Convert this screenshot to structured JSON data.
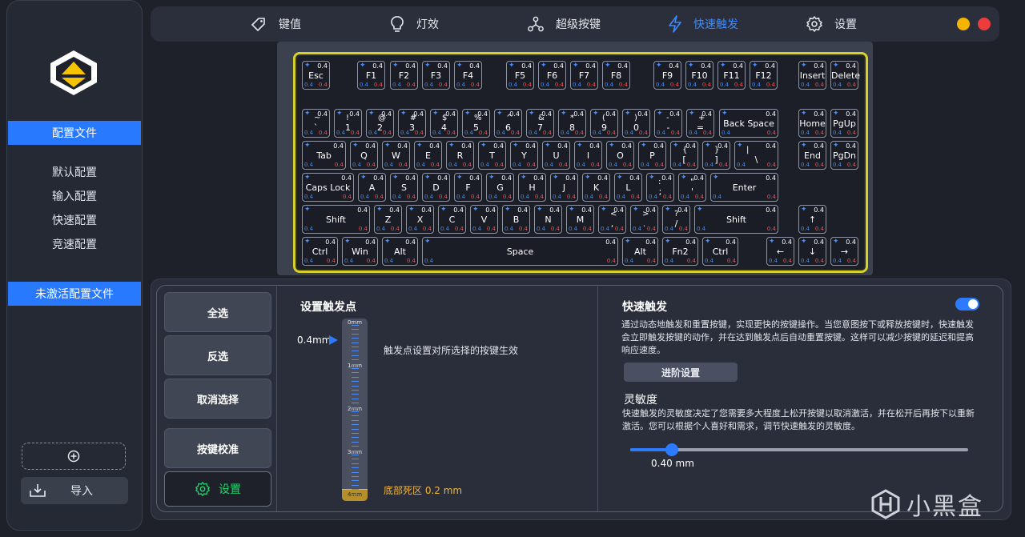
{
  "sidebar": {
    "config_files_label": "配置文件",
    "profiles": [
      "默认配置",
      "输入配置",
      "快速配置",
      "竞速配置"
    ],
    "inactive_label": "未激活配置文件",
    "import_label": "导入"
  },
  "topnav": {
    "tabs": [
      {
        "label": "键值",
        "icon": "tag-icon"
      },
      {
        "label": "灯效",
        "icon": "bulb-icon"
      },
      {
        "label": "超级按键",
        "icon": "nodes-icon"
      },
      {
        "label": "快速触发",
        "icon": "bolt-icon",
        "active": true
      },
      {
        "label": "设置",
        "icon": "gear-icon"
      }
    ],
    "colors": {
      "minimize": "#f5b400",
      "close": "#ee3b3b",
      "active": "#3d8bff"
    }
  },
  "keyboard": {
    "value": "0.4",
    "rows": [
      [
        [
          "Esc"
        ],
        [
          "F1"
        ],
        [
          "F2"
        ],
        [
          "F3"
        ],
        [
          "F4"
        ],
        [
          "F5"
        ],
        [
          "F6"
        ],
        [
          "F7"
        ],
        [
          "F8"
        ],
        [
          "F9"
        ],
        [
          "F10"
        ],
        [
          "F11"
        ],
        [
          "F12"
        ],
        [
          "Insert"
        ],
        [
          "Delete"
        ]
      ],
      [
        [
          "~",
          "`"
        ],
        [
          "!",
          "1"
        ],
        [
          "@",
          "2"
        ],
        [
          "#",
          "3"
        ],
        [
          "$",
          "4"
        ],
        [
          "%",
          "5"
        ],
        [
          "^",
          "6"
        ],
        [
          "&",
          "7"
        ],
        [
          "*",
          "8"
        ],
        [
          "(",
          "9"
        ],
        [
          ")",
          "0"
        ],
        [
          "-",
          "-"
        ],
        [
          "+",
          "="
        ],
        [
          "Back Space"
        ],
        [
          "Home"
        ],
        [
          "PgUp"
        ]
      ],
      [
        [
          "Tab"
        ],
        [
          "Q"
        ],
        [
          "W"
        ],
        [
          "E"
        ],
        [
          "R"
        ],
        [
          "T"
        ],
        [
          "Y"
        ],
        [
          "U"
        ],
        [
          "I"
        ],
        [
          "O"
        ],
        [
          "P"
        ],
        [
          "{",
          "["
        ],
        [
          "}",
          "]"
        ],
        [
          "|",
          "\\"
        ],
        [
          "End"
        ],
        [
          "PgDn"
        ]
      ],
      [
        [
          "Caps Lock"
        ],
        [
          "A"
        ],
        [
          "S"
        ],
        [
          "D"
        ],
        [
          "F"
        ],
        [
          "G"
        ],
        [
          "H"
        ],
        [
          "J"
        ],
        [
          "K"
        ],
        [
          "L"
        ],
        [
          ":",
          ";"
        ],
        [
          "\"",
          "'"
        ],
        [
          "Enter"
        ]
      ],
      [
        [
          "Shift"
        ],
        [
          "Z"
        ],
        [
          "X"
        ],
        [
          "C"
        ],
        [
          "V"
        ],
        [
          "B"
        ],
        [
          "N"
        ],
        [
          "M"
        ],
        [
          "<",
          ","
        ],
        [
          ">",
          "."
        ],
        [
          "?",
          "/"
        ],
        [
          "Shift"
        ],
        [
          "↑"
        ]
      ],
      [
        [
          "Ctrl"
        ],
        [
          "Win"
        ],
        [
          "Alt"
        ],
        [
          "Space"
        ],
        [
          "Alt"
        ],
        [
          "Fn2"
        ],
        [
          "Ctrl"
        ],
        [
          "←"
        ],
        [
          "↓"
        ],
        [
          "→"
        ]
      ]
    ]
  },
  "actions": {
    "select_all": "全选",
    "invert": "反选",
    "deselect": "取消选择",
    "calibrate": "按键校准",
    "settings": "设置"
  },
  "trigger": {
    "title": "设置触发点",
    "current_value": "0.4mm",
    "desc": "触发点设置对所选择的按键生效",
    "ruler_labels": [
      "0mm",
      "1mm",
      "2mm",
      "3mm",
      "4mm"
    ],
    "dead_zone": "底部死区 0.2 mm",
    "level_fraction": 0.1
  },
  "rapid": {
    "title": "快速触发",
    "enabled": true,
    "desc": "通过动态地触发和重置按键，实现更快的按键操作。当您意图按下或释放按键时，快速触发会立即触发按键的动作，并在达到触发点后自动重置按键。这样可以减少按键的延迟和提高响应速度。",
    "advanced_label": "进阶设置",
    "sens_title": "灵敏度",
    "sens_desc": "快速触发的灵敏度决定了您需要多大程度上松开按键以取消激活，并在松开后再按下以重新激活。您可以根据个人喜好和需求，调节快速触发的灵敏度。",
    "sens_value": "0.40 mm",
    "sens_fraction": 0.1
  },
  "watermark": "小黑盒"
}
